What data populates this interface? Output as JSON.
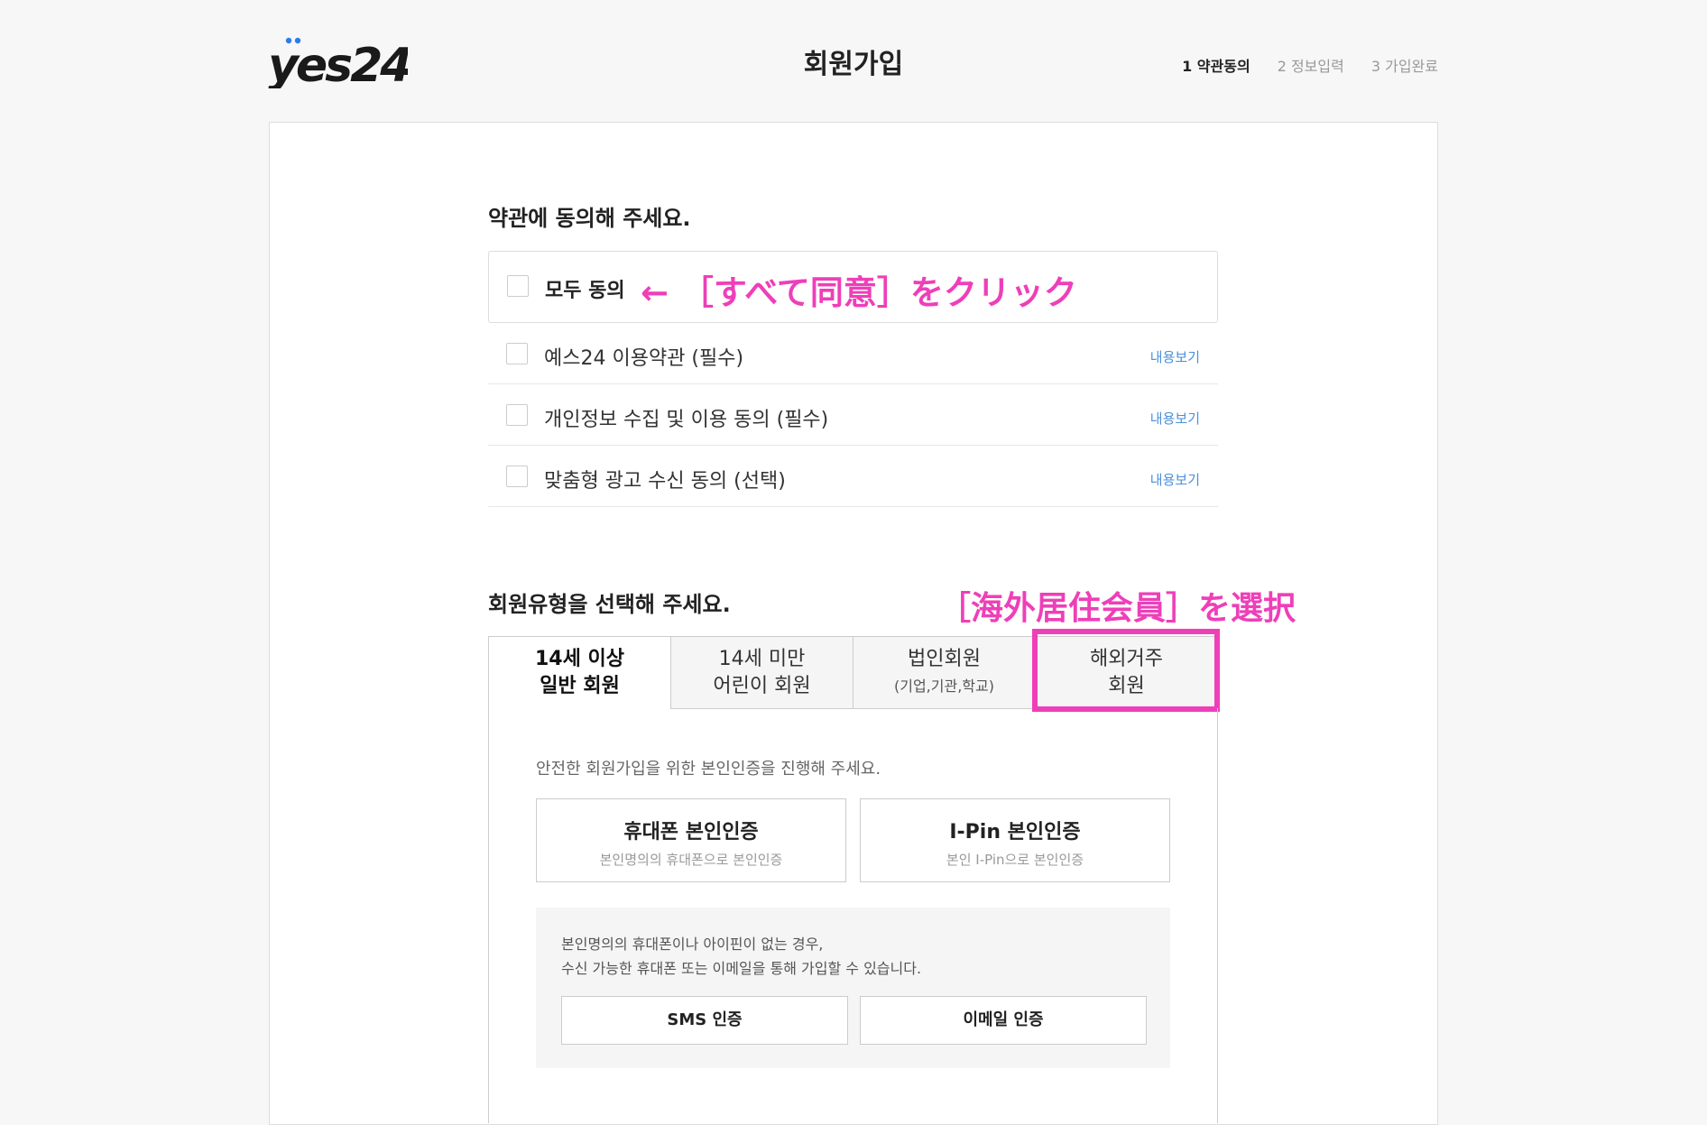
{
  "header": {
    "logo_text": "yes24",
    "page_title": "회원가입",
    "steps": [
      "1 약관동의",
      "2 정보입력",
      "3 가입완료"
    ]
  },
  "terms": {
    "section_title": "약관에 동의해 주세요.",
    "agree_all": "모두 동의",
    "view_label": "내용보기",
    "items": [
      "예스24 이용약관 (필수)",
      "개인정보 수집 및 이용 동의 (필수)",
      "맞춤형 광고 수신 동의 (선택)"
    ]
  },
  "membership": {
    "section_title": "회원유형을 선택해 주세요.",
    "tabs": [
      {
        "line1": "14세 이상",
        "line2": "일반 회원"
      },
      {
        "line1": "14세 미만",
        "line2": "어린이 회원"
      },
      {
        "line1": "법인회원",
        "sub": "(기업,기관,학교)"
      },
      {
        "line1": "해외거주",
        "line2": "회원"
      }
    ]
  },
  "verification": {
    "description": "안전한 회원가입을 위한 본인인증을 진행해 주세요.",
    "phone": {
      "title": "휴대폰 본인인증",
      "sub": "본인명의의 휴대폰으로 본인인증"
    },
    "ipin": {
      "title": "I-Pin 본인인증",
      "sub": "본인 I-Pin으로 본인인증"
    },
    "alt_line1": "본인명의의 휴대폰이나 아이핀이 없는 경우,",
    "alt_line2": "수신 가능한 휴대폰 또는 이메일을 통해 가입할 수 있습니다.",
    "sms_button": "SMS 인증",
    "email_button": "이메일 인증"
  },
  "annotations": {
    "agree_all_note": "← ［すべて同意］をクリック",
    "overseas_note": "［海外居住会員］を選択",
    "color": "#ee3fb9"
  }
}
